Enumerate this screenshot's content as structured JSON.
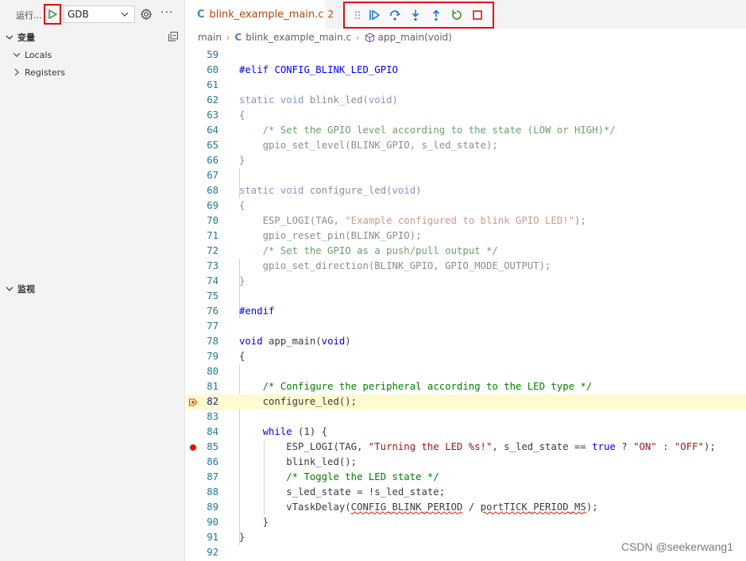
{
  "run": {
    "label": "运行...",
    "config": "GDB"
  },
  "sidebar": {
    "variables_title": "变量",
    "items": [
      {
        "label": "Locals"
      },
      {
        "label": "Registers"
      }
    ],
    "watch_title": "监视"
  },
  "tab": {
    "icon_letter": "C",
    "filename": "blink_example_main.c",
    "problems": "2"
  },
  "breadcrumb": {
    "folder": "main",
    "file": "blink_example_main.c",
    "symbol": "app_main(void)"
  },
  "editor": {
    "current_line": "82",
    "breakpoint_line": "85",
    "line_numbers": [
      "59",
      "60",
      "61",
      "62",
      "63",
      "64",
      "65",
      "66",
      "67",
      "68",
      "69",
      "70",
      "71",
      "72",
      "73",
      "74",
      "75",
      "76",
      "77",
      "78",
      "79",
      "80",
      "81",
      "82",
      "83",
      "84",
      "85",
      "86",
      "87",
      "88",
      "89",
      "90",
      "91",
      "92"
    ]
  },
  "watermark": "CSDN @seekerwang1"
}
